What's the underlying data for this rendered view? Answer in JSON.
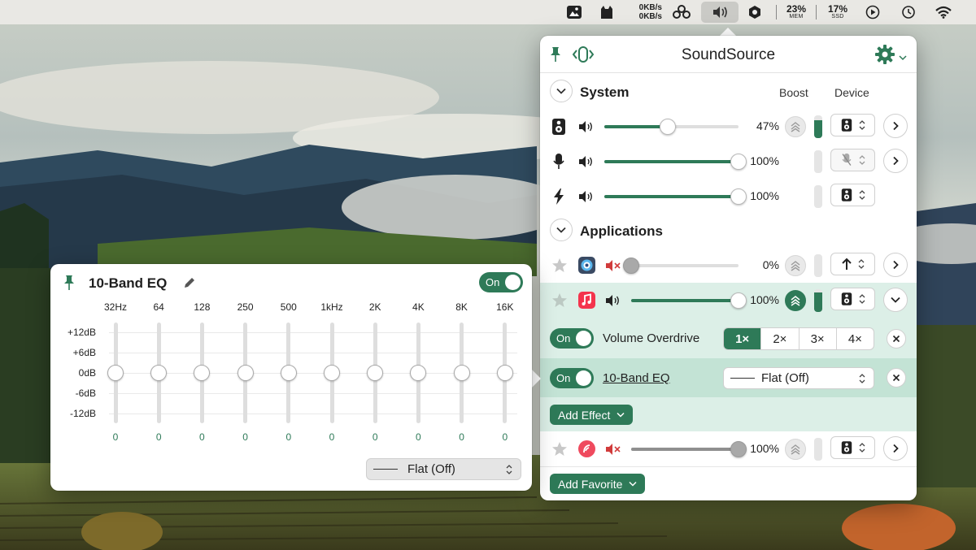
{
  "menubar": {
    "net_up": "0KB/s",
    "net_down": "0KB/s",
    "mem_pct": "23%",
    "mem_label": "MEM",
    "ssd_pct": "17%",
    "ssd_label": "SSD"
  },
  "panel": {
    "title": "SoundSource",
    "system": {
      "title": "System",
      "col_boost": "Boost",
      "col_device": "Device",
      "rows": [
        {
          "name": "Output",
          "volume_pct": 47,
          "label": "47%"
        },
        {
          "name": "Input",
          "volume_pct": 100,
          "label": "100%"
        },
        {
          "name": "Sound Effects",
          "volume_pct": 100,
          "label": "100%"
        }
      ]
    },
    "applications": {
      "title": "Applications",
      "rows": [
        {
          "app": "app-1",
          "volume_pct": 0,
          "label": "0%",
          "muted": true
        },
        {
          "app": "music",
          "volume_pct": 100,
          "label": "100%",
          "muted": false
        },
        {
          "app": "app-3",
          "volume_pct": 100,
          "label": "100%",
          "muted": true
        }
      ],
      "overdrive": {
        "toggle": "On",
        "label": "Volume Overdrive",
        "options": [
          "1×",
          "2×",
          "3×",
          "4×"
        ],
        "selected": "1×"
      },
      "eq_effect": {
        "toggle": "On",
        "label": "10-Band EQ",
        "preset": "Flat (Off)"
      },
      "add_effect": "Add Effect",
      "add_favorite": "Add Favorite"
    }
  },
  "eq": {
    "title": "10-Band EQ",
    "toggle": "On",
    "bands": [
      "32Hz",
      "64",
      "128",
      "250",
      "500",
      "1kHz",
      "2K",
      "4K",
      "8K",
      "16K"
    ],
    "values": [
      "0",
      "0",
      "0",
      "0",
      "0",
      "0",
      "0",
      "0",
      "0",
      "0"
    ],
    "db_labels": [
      "+12dB",
      "+6dB",
      "0dB",
      "-6dB",
      "-12dB"
    ],
    "preset": "Flat (Off)"
  },
  "colors": {
    "accent": "#2e7a58",
    "highlight_row": "#dcefe7",
    "highlight_row_strong": "#c3e3d5"
  }
}
